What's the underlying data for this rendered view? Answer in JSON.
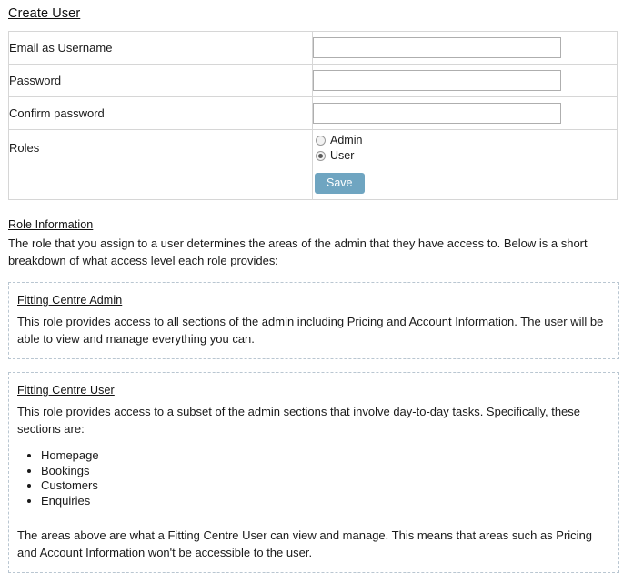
{
  "page": {
    "title": "Create User"
  },
  "form": {
    "rows": [
      {
        "label": "Email as Username",
        "value": "",
        "placeholder": "",
        "type": "text"
      },
      {
        "label": "Password",
        "value": "",
        "placeholder": "",
        "type": "password"
      },
      {
        "label": "Confirm password",
        "value": "",
        "placeholder": "",
        "type": "password"
      }
    ],
    "roles": {
      "label": "Roles",
      "options": [
        {
          "label": "Admin",
          "selected": false
        },
        {
          "label": "User",
          "selected": true
        }
      ]
    },
    "save_label": "Save",
    "save_color": "#6fa5c1"
  },
  "role_information": {
    "heading": "Role Information",
    "intro": "The role that you assign to a user determines the areas of the admin that they have access to. Below is a short breakdown of what access level each role provides:",
    "boxes": [
      {
        "title": "Fitting Centre Admin",
        "paragraph": "This role provides access to all sections of the admin including Pricing and Account Information. The user will be able to view and manage everything you can.",
        "items": [],
        "closing": ""
      },
      {
        "title": "Fitting Centre User",
        "paragraph": "This role provides access to a subset of the admin sections that involve day-to-day tasks. Specifically, these sections are:",
        "items": [
          "Homepage",
          "Bookings",
          "Customers",
          "Enquiries"
        ],
        "closing": "The areas above are what a Fitting Centre User can view and manage. This means that areas such as Pricing and Account Information won't be accessible to the user."
      }
    ]
  }
}
